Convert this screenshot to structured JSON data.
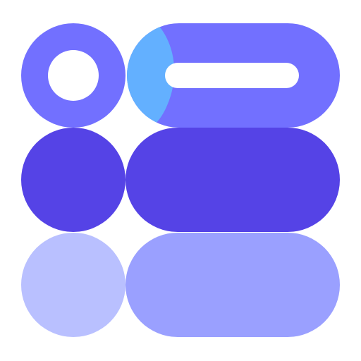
{
  "app_icon": {
    "icon_name": "toggle-list-stack-icon",
    "colors": {
      "background": "#ffffff",
      "top_row": "#7270ff",
      "top_accent": "#63b0ff",
      "middle_row": "#5543e6",
      "bottom_circle": "#b9c0ff",
      "bottom_bar": "#9aa0ff",
      "cutout": "#ffffff"
    }
  }
}
